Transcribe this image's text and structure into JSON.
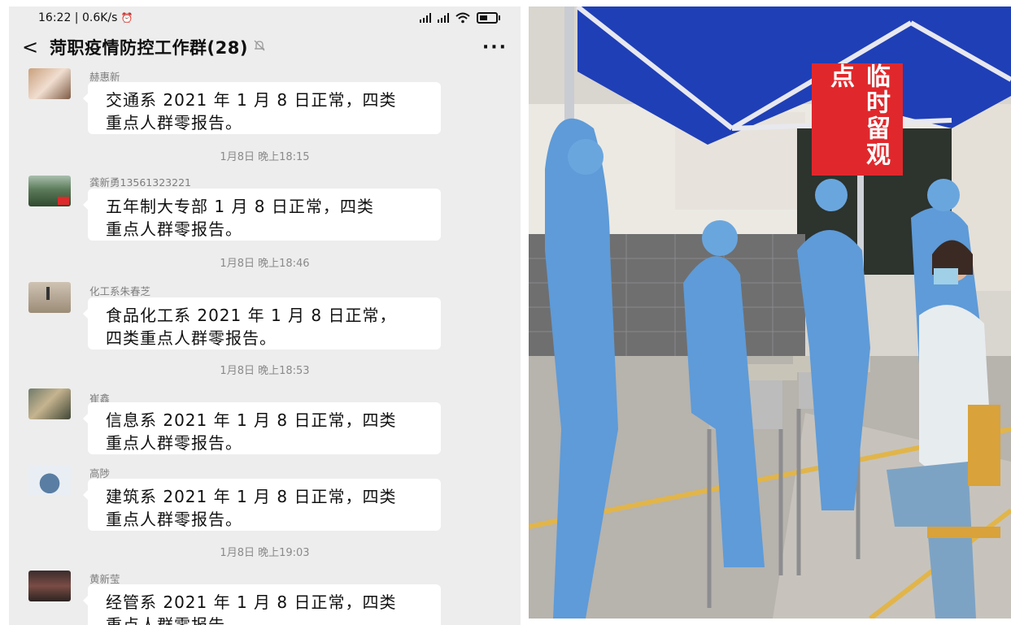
{
  "status_bar": {
    "time_speed": "16:22 | 0.6K/s",
    "alarm_icon": "⏰"
  },
  "header": {
    "title": "菏职疫情防控工作群(28)",
    "mute_icon": "🔕",
    "more": "···",
    "back": "<"
  },
  "messages": [
    {
      "sender": "赫惠新",
      "lines": [
        "交通系 2021 年 1 月 8 日正常，四类",
        "重点人群零报告。"
      ]
    },
    {
      "sender": "龚新勇13561323221",
      "lines": [
        "五年制大专部 1 月 8 日正常，四类",
        "重点人群零报告。"
      ]
    },
    {
      "sender": "化工系朱春芝",
      "lines": [
        "食品化工系 2021 年 1 月 8 日正常，",
        "四类重点人群零报告。"
      ]
    },
    {
      "sender": "崔鑫",
      "lines": [
        "信息系 2021 年 1 月 8 日正常，四类",
        "重点人群零报告。"
      ]
    },
    {
      "sender": "高陟",
      "lines": [
        "建筑系 2021 年 1 月 8 日正常，四类",
        "重点人群零报告。"
      ]
    },
    {
      "sender": "黄新莹",
      "lines": [
        "经管系 2021 年 1 月 8 日正常，四类",
        "重点人群零报告。"
      ]
    }
  ],
  "timestamps": [
    "1月8日 晚上18:15",
    "1月8日 晚上18:46",
    "1月8日 晚上18:53",
    "1月8日 晚上19:03"
  ],
  "photo": {
    "sign_text": "临时留观点"
  }
}
